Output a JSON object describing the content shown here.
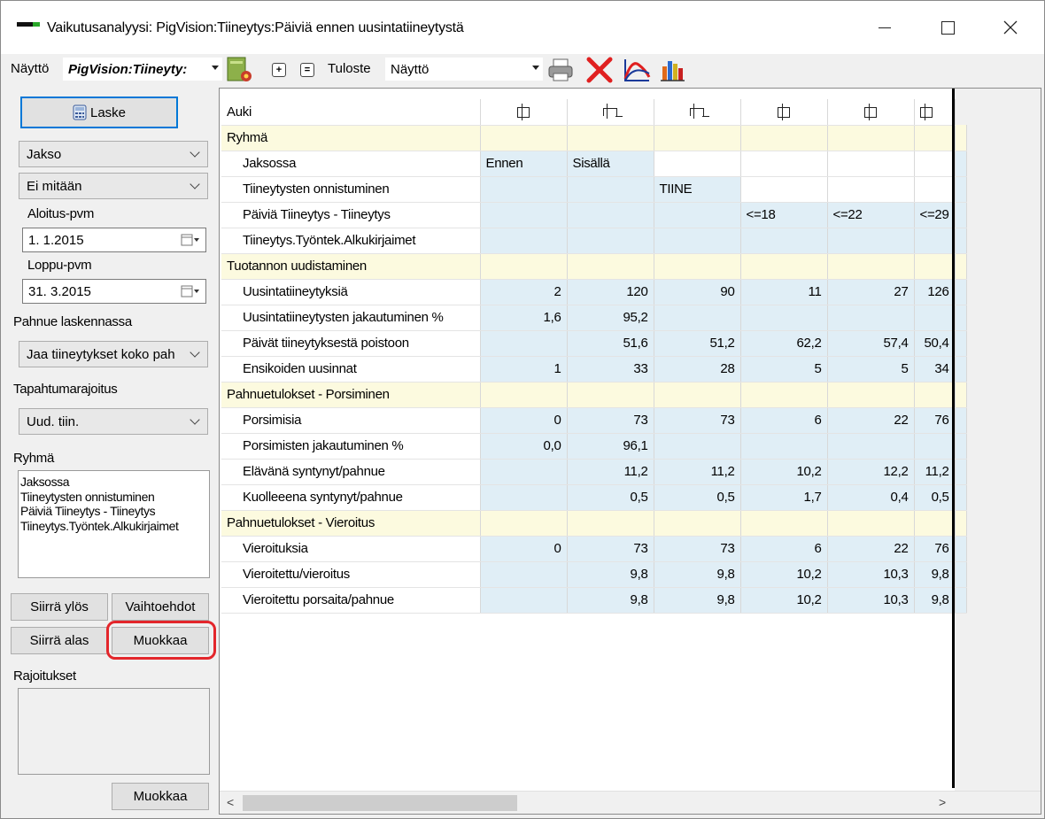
{
  "window": {
    "title": "Vaikutusanalyysi: PigVision:Tiineytys:Päiviä ennen uusintatiineytystä"
  },
  "toolbar": {
    "view_label": "Näyttö",
    "view_value": "PigVision:Tiineyty:",
    "expand_symbol": "+",
    "collapse_symbol": "=",
    "print_label": "Tuloste",
    "print_value": "Näyttö"
  },
  "left": {
    "calc_button": "Laske",
    "period_combo": "Jakso",
    "none_combo": "Ei mitään",
    "start_label": "Aloitus-pvm",
    "start_value": "1.  1.2015",
    "end_label": "Loppu-pvm",
    "end_value": "31.  3.2015",
    "litter_label": "Pahnue laskennassa",
    "litter_combo": "Jaa tiineytykset koko pah",
    "event_label": "Tapahtumarajoitus",
    "event_combo": "Uud. tiin.",
    "group_label": "Ryhmä",
    "group_items": [
      "Jaksossa",
      "Tiineytysten onnistuminen",
      "Päiviä Tiineytys - Tiineytys",
      "Tiineytys.Työntek.Alkukirjaimet"
    ],
    "move_up": "Siirrä ylös",
    "options": "Vaihtoehdot",
    "move_down": "Siirrä alas",
    "edit": "Muokkaa",
    "restrictions_label": "Rajoitukset",
    "edit2": "Muokkaa"
  },
  "grid": {
    "header_label": "Auki",
    "rows": [
      {
        "type": "sec",
        "label": "Ryhmä",
        "cells": [
          "",
          "",
          "",
          "",
          "",
          ""
        ]
      },
      {
        "type": "data",
        "label": "Jaksossa",
        "cells": [
          "Ennen",
          "Sisällä",
          "",
          "",
          "",
          ""
        ],
        "align": "left",
        "bg": [
          "c",
          "c",
          "w",
          "w",
          "w",
          "w"
        ]
      },
      {
        "type": "data",
        "label": "Tiineytysten onnistuminen",
        "cells": [
          "",
          "",
          "TIINE",
          "",
          "",
          ""
        ],
        "align": "left",
        "bg": [
          "c",
          "c",
          "c",
          "w",
          "w",
          "w"
        ]
      },
      {
        "type": "data",
        "label": "Päiviä Tiineytys - Tiineytys",
        "cells": [
          "",
          "",
          "",
          "<=18",
          "<=22",
          "<=29"
        ],
        "align": "left",
        "bg": [
          "c",
          "c",
          "c",
          "c",
          "c",
          "c"
        ]
      },
      {
        "type": "data",
        "label": "Tiineytys.Työntek.Alkukirjaimet",
        "cells": [
          "",
          "",
          "",
          "",
          "",
          ""
        ],
        "align": "left",
        "bg": [
          "c",
          "c",
          "c",
          "c",
          "c",
          "c"
        ]
      },
      {
        "type": "sec",
        "label": "Tuotannon uudistaminen",
        "cells": [
          "",
          "",
          "",
          "",
          "",
          ""
        ]
      },
      {
        "type": "data",
        "label": "Uusintatiineytyksiä",
        "cells": [
          "2",
          "120",
          "90",
          "11",
          "27",
          "126"
        ],
        "align": "right",
        "bg": [
          "c",
          "c",
          "c",
          "c",
          "c",
          "c"
        ]
      },
      {
        "type": "data",
        "label": "Uusintatiineytysten jakautuminen %",
        "cells": [
          "1,6",
          "95,2",
          "",
          "",
          "",
          ""
        ],
        "align": "right",
        "bg": [
          "c",
          "c",
          "c",
          "c",
          "c",
          "c"
        ]
      },
      {
        "type": "data",
        "label": "Päivät tiineytyksestä poistoon",
        "cells": [
          "",
          "51,6",
          "51,2",
          "62,2",
          "57,4",
          "50,4"
        ],
        "align": "right",
        "bg": [
          "c",
          "c",
          "c",
          "c",
          "c",
          "c"
        ]
      },
      {
        "type": "data",
        "label": "Ensikoiden uusinnat",
        "cells": [
          "1",
          "33",
          "28",
          "5",
          "5",
          "34"
        ],
        "align": "right",
        "bg": [
          "c",
          "c",
          "c",
          "c",
          "c",
          "c"
        ]
      },
      {
        "type": "sec",
        "label": "Pahnuetulokset - Porsiminen",
        "cells": [
          "",
          "",
          "",
          "",
          "",
          ""
        ]
      },
      {
        "type": "data",
        "label": "Porsimisia",
        "cells": [
          "0",
          "73",
          "73",
          "6",
          "22",
          "76"
        ],
        "align": "right",
        "bg": [
          "c",
          "c",
          "c",
          "c",
          "c",
          "c"
        ]
      },
      {
        "type": "data",
        "label": "Porsimisten jakautuminen %",
        "cells": [
          "0,0",
          "96,1",
          "",
          "",
          "",
          ""
        ],
        "align": "right",
        "bg": [
          "c",
          "c",
          "c",
          "c",
          "c",
          "c"
        ]
      },
      {
        "type": "data",
        "label": "Elävänä syntynyt/pahnue",
        "cells": [
          "",
          "11,2",
          "11,2",
          "10,2",
          "12,2",
          "11,2"
        ],
        "align": "right",
        "bg": [
          "c",
          "c",
          "c",
          "c",
          "c",
          "c"
        ]
      },
      {
        "type": "data",
        "label": "Kuolleeena syntynyt/pahnue",
        "cells": [
          "",
          "0,5",
          "0,5",
          "1,7",
          "0,4",
          "0,5"
        ],
        "align": "right",
        "bg": [
          "c",
          "c",
          "c",
          "c",
          "c",
          "c"
        ]
      },
      {
        "type": "sec",
        "label": "Pahnuetulokset - Vieroitus",
        "cells": [
          "",
          "",
          "",
          "",
          "",
          ""
        ]
      },
      {
        "type": "data",
        "label": "Vieroituksia",
        "cells": [
          "0",
          "73",
          "73",
          "6",
          "22",
          "76"
        ],
        "align": "right",
        "bg": [
          "c",
          "c",
          "c",
          "c",
          "c",
          "c"
        ]
      },
      {
        "type": "data",
        "label": "Vieroitettu/vieroitus",
        "cells": [
          "",
          "9,8",
          "9,8",
          "10,2",
          "10,3",
          "9,8"
        ],
        "align": "right",
        "bg": [
          "c",
          "c",
          "c",
          "c",
          "c",
          "c"
        ]
      },
      {
        "type": "data",
        "label": "Vieroitettu porsaita/pahnue",
        "cells": [
          "",
          "9,8",
          "9,8",
          "10,2",
          "10,3",
          "9,8"
        ],
        "align": "right",
        "bg": [
          "c",
          "c",
          "c",
          "c",
          "c",
          "c"
        ]
      }
    ]
  },
  "colors": {
    "highlight_ring": "#e3262b",
    "section_bg": "#fcfadf",
    "cell_bg": "#e0eef6",
    "calc_button_border": "#0078d7"
  },
  "icons": [
    "app-icon",
    "report-icon",
    "printer-icon",
    "delete-icon",
    "chart-curve-icon",
    "bar-chart-icon",
    "calendar-icon",
    "calculator-icon"
  ]
}
